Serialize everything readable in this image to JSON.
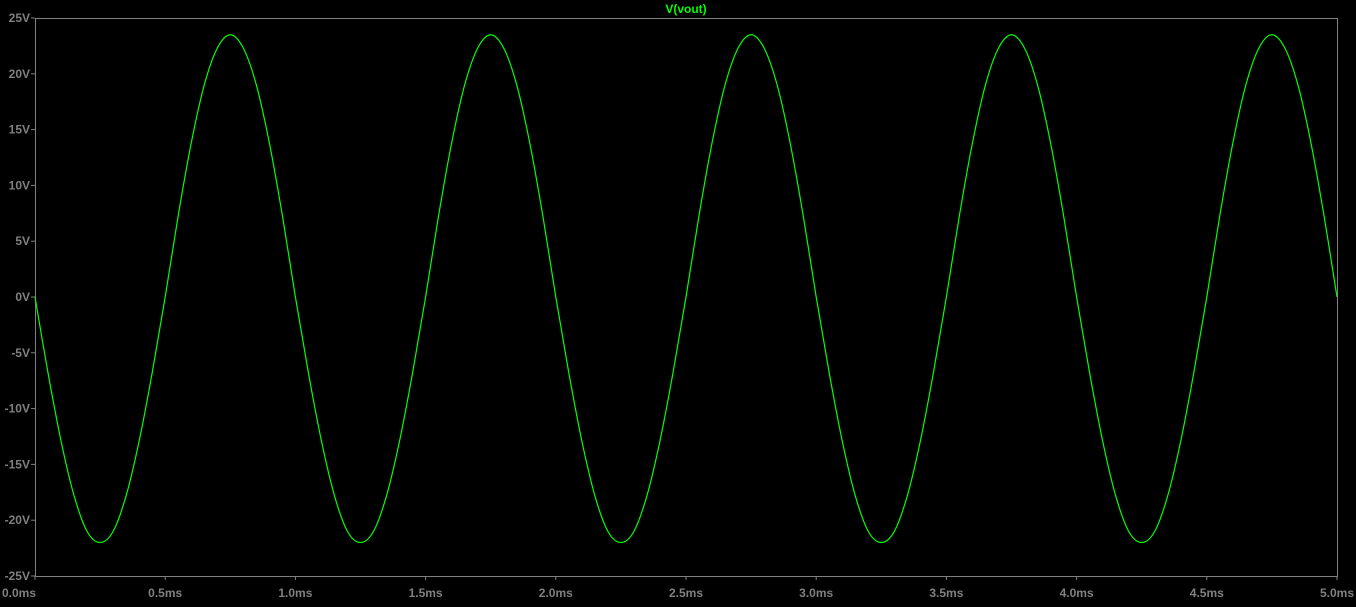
{
  "colors": {
    "background": "#000000",
    "axes": "#808080",
    "tick_label": "#808080",
    "trace": "#00ff00",
    "title": "#00ff00"
  },
  "chart_data": {
    "type": "line",
    "title": "V(vout)",
    "xlabel": "",
    "ylabel": "",
    "xlim": [
      0,
      5.0
    ],
    "ylim": [
      -25,
      25
    ],
    "grid": false,
    "x_ticks": [
      0,
      0.5,
      1.0,
      1.5,
      2.0,
      2.5,
      3.0,
      3.5,
      4.0,
      4.5,
      5.0
    ],
    "x_tick_labels": [
      "0.0ms",
      "0.5ms",
      "1.0ms",
      "1.5ms",
      "2.0ms",
      "2.5ms",
      "3.0ms",
      "3.5ms",
      "4.0ms",
      "4.5ms",
      "5.0ms"
    ],
    "y_ticks": [
      25,
      20,
      15,
      10,
      5,
      0,
      -5,
      -10,
      -15,
      -20,
      -25
    ],
    "y_tick_labels": [
      "25V",
      "20V",
      "15V",
      "10V",
      "5V",
      "0V",
      "-5V",
      "-10V",
      "-15V",
      "-20V",
      "-25V"
    ],
    "series": [
      {
        "name": "V(vout)",
        "color": "#00ff00",
        "x_unit": "ms",
        "y_unit": "V",
        "x": [
          0,
          0.05,
          0.1,
          0.15,
          0.2,
          0.25,
          0.3,
          0.35,
          0.4,
          0.45,
          0.5,
          0.55,
          0.6,
          0.65,
          0.7,
          0.75,
          0.8,
          0.85,
          0.9,
          0.95,
          1.0,
          1.05,
          1.1,
          1.15,
          1.2,
          1.25,
          1.3,
          1.35,
          1.4,
          1.45,
          1.5,
          1.55,
          1.6,
          1.65,
          1.7,
          1.75,
          1.8,
          1.85,
          1.9,
          1.95,
          2.0,
          2.05,
          2.1,
          2.15,
          2.2,
          2.25,
          2.3,
          2.35,
          2.4,
          2.45,
          2.5,
          2.55,
          2.6,
          2.65,
          2.7,
          2.75,
          2.8,
          2.85,
          2.9,
          2.95,
          3.0,
          3.05,
          3.1,
          3.15,
          3.2,
          3.25,
          3.3,
          3.35,
          3.4,
          3.45,
          3.5,
          3.55,
          3.6,
          3.65,
          3.7,
          3.75,
          3.8,
          3.85,
          3.9,
          3.95,
          4.0,
          4.05,
          4.1,
          4.15,
          4.2,
          4.25,
          4.3,
          4.35,
          4.4,
          4.45,
          4.5,
          4.55,
          4.6,
          4.65,
          4.7,
          4.75,
          4.8,
          4.85,
          4.9,
          4.95,
          5.0
        ],
        "y": [
          0.0,
          -6.8,
          -12.9,
          -17.8,
          -21.0,
          -22.0,
          -21.0,
          -17.8,
          -12.9,
          -6.8,
          0.0,
          7.3,
          13.8,
          19.0,
          22.3,
          23.5,
          22.3,
          19.0,
          13.8,
          7.3,
          0.0,
          -6.8,
          -12.9,
          -17.8,
          -21.0,
          -22.0,
          -21.0,
          -17.8,
          -12.9,
          -6.8,
          0.0,
          7.3,
          13.8,
          19.0,
          22.3,
          23.5,
          22.3,
          19.0,
          13.8,
          7.3,
          0.0,
          -6.8,
          -12.9,
          -17.8,
          -21.0,
          -22.0,
          -21.0,
          -17.8,
          -12.9,
          -6.8,
          0.0,
          7.3,
          13.8,
          19.0,
          22.3,
          23.5,
          22.3,
          19.0,
          13.8,
          7.3,
          0.0,
          -6.8,
          -12.9,
          -17.8,
          -21.0,
          -22.0,
          -21.0,
          -17.8,
          -12.9,
          -6.8,
          0.0,
          7.3,
          13.8,
          19.0,
          22.3,
          23.5,
          22.3,
          19.0,
          13.8,
          7.3,
          0.0,
          -6.8,
          -12.9,
          -17.8,
          -21.0,
          -22.0,
          -21.0,
          -17.8,
          -12.9,
          -6.8,
          0.0,
          7.3,
          13.8,
          19.0,
          22.3,
          23.5,
          22.3,
          19.0,
          13.8,
          7.3,
          0.0
        ]
      }
    ]
  }
}
